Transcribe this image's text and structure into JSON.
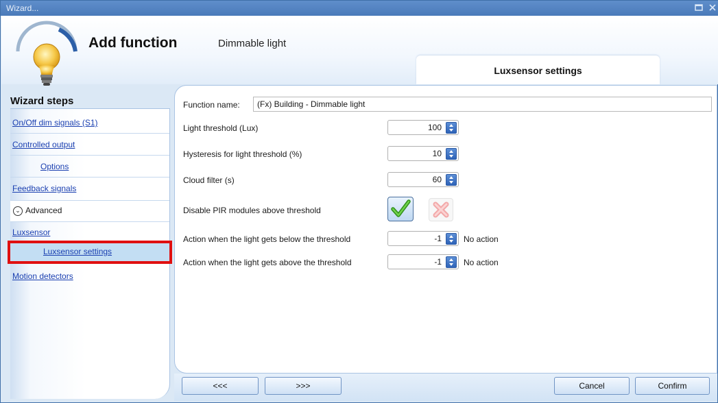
{
  "window": {
    "title": "Wizard..."
  },
  "header": {
    "title": "Add function",
    "subtitle": "Dimmable light",
    "active_tab": "Luxsensor settings"
  },
  "sidebar": {
    "title": "Wizard steps",
    "items": [
      {
        "label": "On/Off dim signals (S1)"
      },
      {
        "label": "Controlled output"
      },
      {
        "label": "Options"
      },
      {
        "label": "Feedback signals"
      },
      {
        "label": "Advanced"
      },
      {
        "label": "Luxsensor"
      },
      {
        "label": "Luxsensor settings"
      },
      {
        "label": "Motion detectors"
      }
    ]
  },
  "form": {
    "function_name_label": "Function name:",
    "function_name_value": "(Fx) Building - Dimmable light",
    "light_threshold_label": "Light threshold (Lux)",
    "light_threshold_value": "100",
    "hysteresis_label": "Hysteresis for light threshold (%)",
    "hysteresis_value": "10",
    "cloud_filter_label": "Cloud filter (s)",
    "cloud_filter_value": "60",
    "disable_pir_label": "Disable PIR modules above threshold",
    "below_label": "Action when the light gets below the threshold",
    "below_value": "-1",
    "below_action": "No action",
    "above_label": "Action when the light gets above the threshold",
    "above_value": "-1",
    "above_action": "No action"
  },
  "buttons": {
    "prev": "<<<",
    "next": ">>>",
    "cancel": "Cancel",
    "confirm": "Confirm"
  },
  "colors": {
    "accent": "#2e63b8",
    "selection_border": "#e01010",
    "link": "#1a3fb0"
  }
}
